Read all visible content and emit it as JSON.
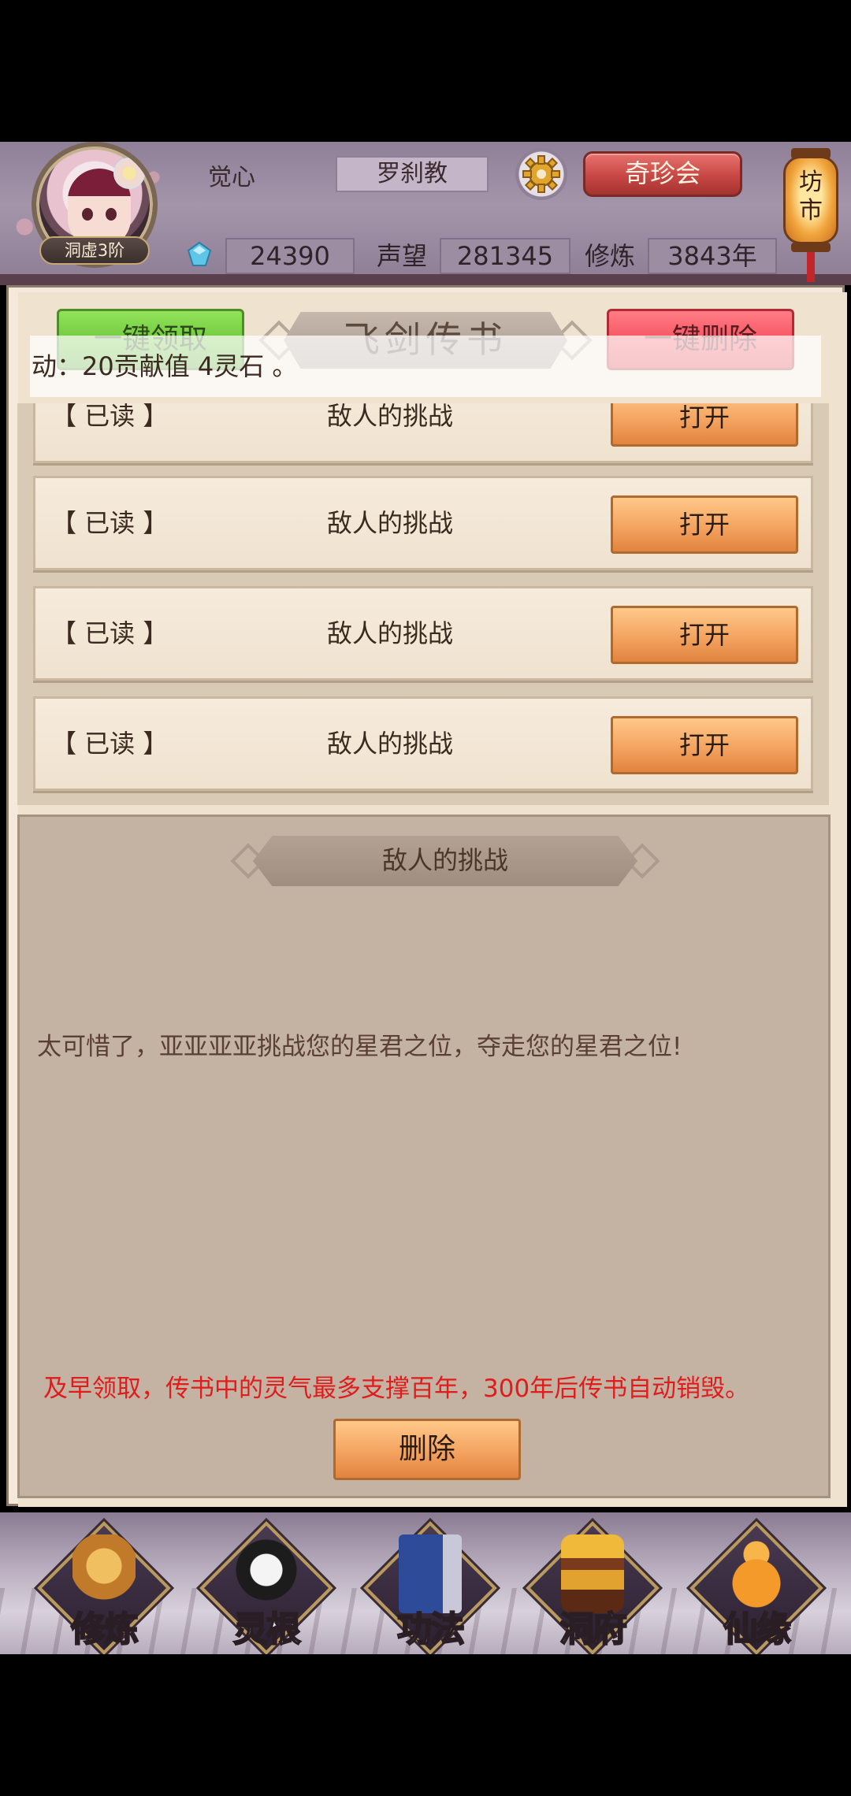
{
  "header": {
    "avatar_rank": "洞虚3阶",
    "player_name": "觉心",
    "sect": "罗刹教",
    "treasure_button": "奇珍会",
    "market_lantern": "坊市",
    "spirit_stones": "24390",
    "prestige_label": "声望",
    "prestige_value": "281345",
    "cultivation_label": "修炼",
    "cultivation_value": "3843年"
  },
  "panel": {
    "title": "飞剑传书",
    "claim_all_button": "一键领取",
    "delete_all_button": "一键删除",
    "notice": "动：20贡献值 4灵石 。"
  },
  "mail_list": [
    {
      "status": "【 已读 】",
      "title": "敌人的挑战",
      "button": "打开"
    },
    {
      "status": "【 已读 】",
      "title": "敌人的挑战",
      "button": "打开"
    },
    {
      "status": "【 已读 】",
      "title": "敌人的挑战",
      "button": "打开"
    },
    {
      "status": "【 已读 】",
      "title": "敌人的挑战",
      "button": "打开"
    }
  ],
  "detail": {
    "title": "敌人的挑战",
    "body": "太可惜了，亚亚亚亚挑战您的星君之位，夺走您的星君之位!",
    "warning": "及早领取，传书中的灵气最多支撑百年，300年后传书自动销毁。",
    "delete_button": "删除"
  },
  "nav": [
    {
      "label": "修炼",
      "icon": "cultivation-icon",
      "active": true
    },
    {
      "label": "灵根",
      "icon": "spirit-root-icon",
      "active": false
    },
    {
      "label": "功法",
      "icon": "technique-book-icon",
      "active": false
    },
    {
      "label": "洞府",
      "icon": "cave-dwelling-icon",
      "active": false
    },
    {
      "label": "仙缘",
      "icon": "immortal-fate-icon",
      "active": false
    }
  ],
  "colors": {
    "warning_red": "#e01c1c",
    "claim_green": "#6cc53b",
    "delete_red": "#f34d5b",
    "open_orange": "#f4a360",
    "active_nav_yellow": "#ffd23a"
  }
}
